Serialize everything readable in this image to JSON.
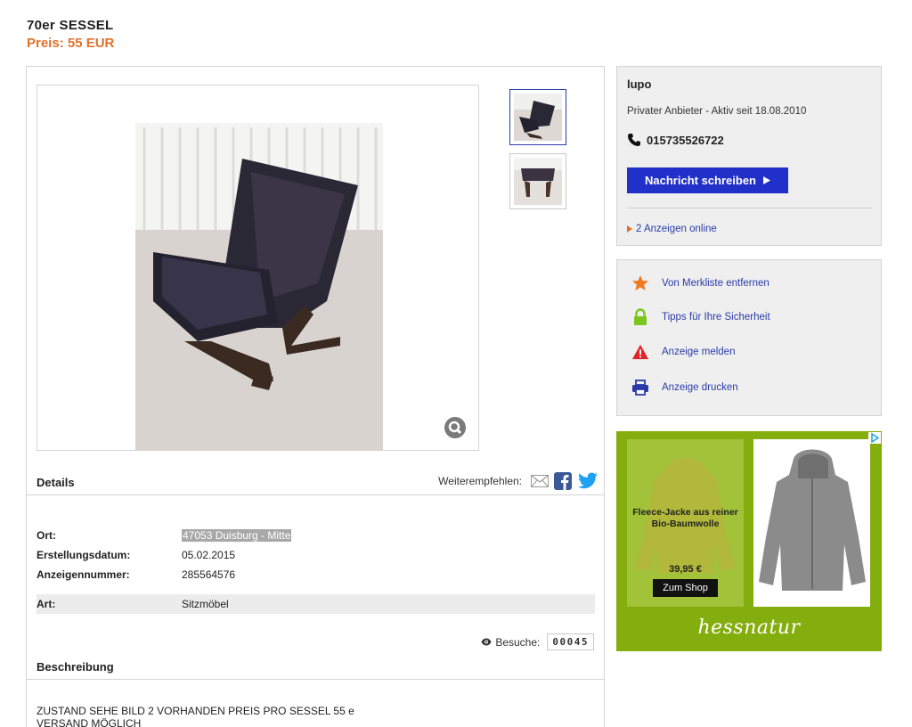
{
  "listing": {
    "title": "70er SESSEL",
    "price": "Preis: 55 EUR"
  },
  "details": {
    "heading": "Details",
    "share_label": "Weiterempfehlen:",
    "rows": [
      {
        "label": "Ort:",
        "value": "47053 Duisburg - Mitte"
      },
      {
        "label": "Erstellungsdatum:",
        "value": "05.02.2015"
      },
      {
        "label": "Anzeigennummer:",
        "value": "285564576"
      },
      {
        "label": "Art:",
        "value": "Sitzmöbel"
      }
    ],
    "visits_label": "Besuche:",
    "visits_count": "00045"
  },
  "description": {
    "heading": "Beschreibung",
    "line1": "ZUSTAND SEHE BILD 2 VORHANDEN PREIS PRO SESSEL 55 e",
    "line2": "VERSAND MÖGLICH"
  },
  "seller": {
    "name": "lupo",
    "since": "Privater Anbieter - Aktiv seit 18.08.2010",
    "phone": "015735526722",
    "message_button": "Nachricht schreiben",
    "more_ads": "2 Anzeigen online"
  },
  "actions": [
    {
      "label": "Von Merkliste entfernen",
      "icon": "star-icon"
    },
    {
      "label": "Tipps für Ihre Sicherheit",
      "icon": "lock-icon"
    },
    {
      "label": "Anzeige melden",
      "icon": "warning-icon"
    },
    {
      "label": "Anzeige drucken",
      "icon": "printer-icon"
    }
  ],
  "ad": {
    "text": "Fleece-Jacke aus reiner Bio-Baumwolle",
    "price": "39,95 €",
    "button": "Zum Shop",
    "brand": "hessnatur"
  },
  "colors": {
    "accent_orange": "#e0712a",
    "link_blue": "#2a3ba8",
    "button_blue": "#2030c8",
    "ad_green": "#84ad0e"
  }
}
